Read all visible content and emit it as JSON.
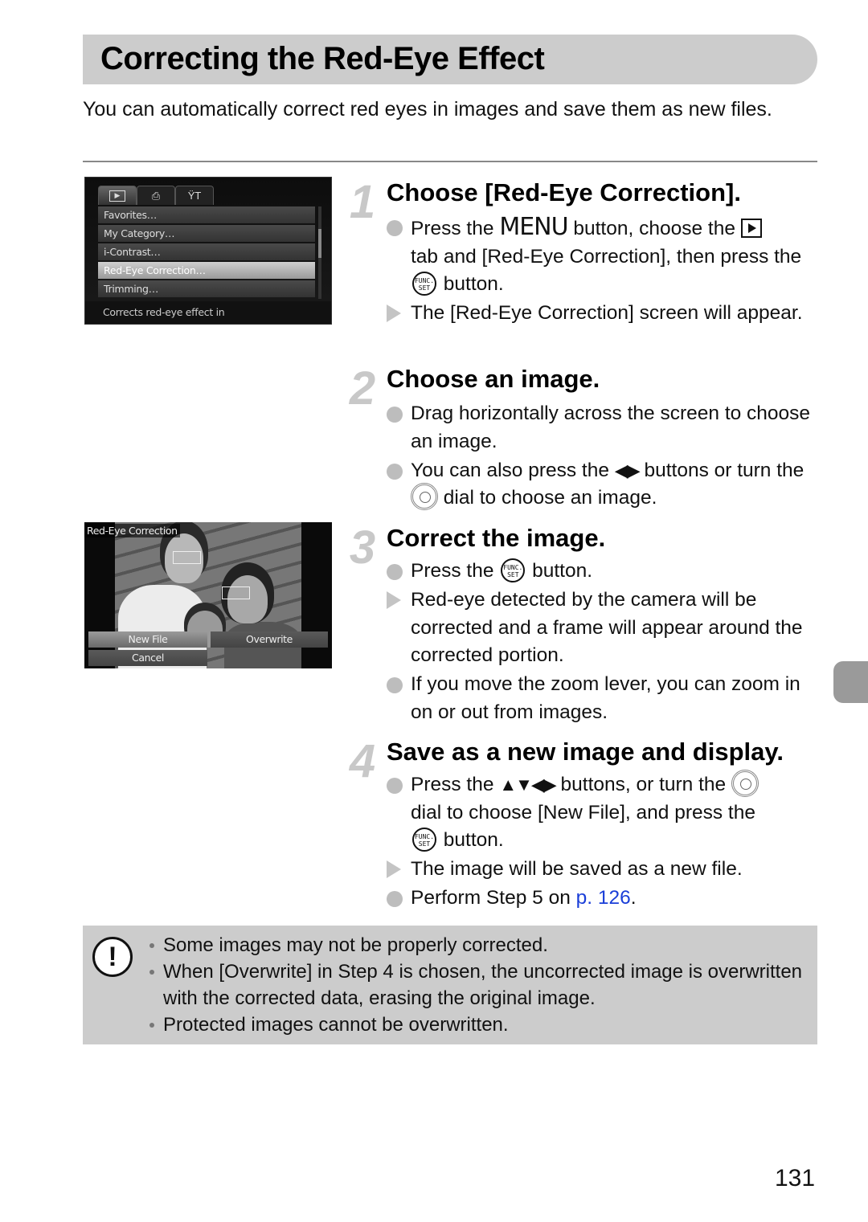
{
  "page": {
    "title": "Correcting the Red-Eye Effect",
    "intro": "You can automatically correct red eyes in images and save them as new files.",
    "page_number": "131"
  },
  "screen1": {
    "tabs": [
      {
        "icon": "playback-tab-icon",
        "active": true
      },
      {
        "icon": "print-tab-icon",
        "active": false
      },
      {
        "icon": "settings-tab-icon",
        "active": false
      }
    ],
    "menu_items": [
      {
        "label": "Favorites…",
        "selected": false
      },
      {
        "label": "My Category…",
        "selected": false
      },
      {
        "label": "i-Contrast…",
        "selected": false
      },
      {
        "label": "Red-Eye Correction…",
        "selected": true
      },
      {
        "label": "Trimming…",
        "selected": false
      }
    ],
    "description": "Corrects red-eye effect in"
  },
  "screen2": {
    "title": "Red-Eye Correction",
    "buttons": {
      "new_file": "New File",
      "overwrite": "Overwrite",
      "cancel": "Cancel"
    }
  },
  "steps": [
    {
      "number": "1",
      "title": "Choose [Red-Eye Correction].",
      "bullets": [
        {
          "type": "dot",
          "parts": [
            "Press the ",
            "MENU",
            " button, choose the ",
            "[play]",
            " tab and [Red-Eye Correction], then press the ",
            "[FUNC]",
            " button."
          ]
        },
        {
          "type": "arrow",
          "text": "The [Red-Eye Correction] screen will appear."
        }
      ]
    },
    {
      "number": "2",
      "title": "Choose an image.",
      "bullets": [
        {
          "type": "dot",
          "text": "Drag horizontally across the screen to choose an image."
        },
        {
          "type": "dot",
          "parts": [
            "You can also press the ",
            "◀▶",
            " buttons or turn the ",
            "[dial]",
            " dial to choose an image."
          ]
        }
      ]
    },
    {
      "number": "3",
      "title": "Correct the image.",
      "bullets": [
        {
          "type": "dot",
          "parts": [
            "Press the ",
            "[FUNC]",
            " button."
          ]
        },
        {
          "type": "arrow",
          "text": "Red-eye detected by the camera will be corrected and a frame will appear around the corrected portion."
        },
        {
          "type": "dot",
          "text": "If you move the zoom lever, you can zoom in on or out from images."
        }
      ]
    },
    {
      "number": "4",
      "title": "Save as a new image and display.",
      "bullets": [
        {
          "type": "dot",
          "parts": [
            "Press the ",
            "▲▼◀▶",
            " buttons, or turn the ",
            "[dial]",
            " dial to choose [New File], and press the ",
            "[FUNC]",
            " button."
          ]
        },
        {
          "type": "arrow",
          "text": "The image will be saved as a new file."
        },
        {
          "type": "dot",
          "parts": [
            "Perform Step 5 on ",
            "p. 126",
            "."
          ]
        }
      ]
    }
  ],
  "glyphs": {
    "menu": "MENU",
    "func_top": "FUNC.",
    "func_bottom": "SET",
    "lr_arrows": "◀▶",
    "udlr_arrows": "▲▼◀▶",
    "caution": "!"
  },
  "caution": {
    "items": [
      "Some images may not be properly corrected.",
      "When [Overwrite] in Step 4 is chosen, the uncorrected image is overwritten with the corrected data, erasing the original image.",
      "Protected images cannot be overwritten."
    ]
  },
  "colors": {
    "title_bar": "#cccccc",
    "link": "#1a3ed8",
    "step_number": "#c8c8c8",
    "side_tab": "#9a9a9a"
  }
}
